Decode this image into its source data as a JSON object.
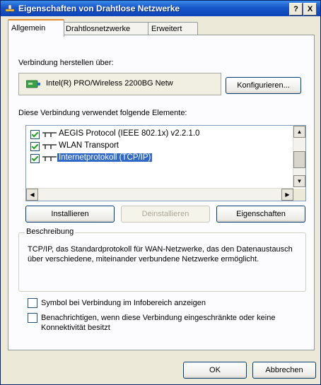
{
  "window": {
    "title": "Eigenschaften von Drahtlose Netzwerke",
    "help_label": "?",
    "close_label": "X"
  },
  "tabs": [
    {
      "label": "Allgemein",
      "active": true
    },
    {
      "label": "Drahtlosnetzwerke",
      "active": false
    },
    {
      "label": "Erweitert",
      "active": false
    }
  ],
  "connection": {
    "label": "Verbindung herstellen über:",
    "adapter": "Intel(R) PRO/Wireless 2200BG Netw",
    "configure_button": "Konfigurieren..."
  },
  "components": {
    "label": "Diese Verbindung verwendet folgende Elemente:",
    "items": [
      {
        "label": "AEGIS Protocol (IEEE 802.1x) v2.2.1.0",
        "checked": true,
        "selected": false
      },
      {
        "label": "WLAN Transport",
        "checked": true,
        "selected": false
      },
      {
        "label": "Internetprotokoll (TCP/IP)",
        "checked": true,
        "selected": true
      }
    ]
  },
  "actions": {
    "install": "Installieren",
    "uninstall": "Deinstallieren",
    "properties": "Eigenschaften"
  },
  "description": {
    "title": "Beschreibung",
    "text": "TCP/IP, das Standardprotokoll für WAN-Netzwerke, das den Datenaustausch über verschiedene, miteinander verbundene Netzwerke ermöglicht."
  },
  "options": {
    "show_icon": {
      "label": "Symbol bei Verbindung im Infobereich anzeigen",
      "checked": false
    },
    "notify": {
      "label": "Benachrichtigen, wenn diese Verbindung eingeschränkte oder keine Konnektivität besitzt",
      "checked": false
    }
  },
  "dialog_buttons": {
    "ok": "OK",
    "cancel": "Abbrechen"
  },
  "colors": {
    "titlebar": "#1756c9",
    "selection": "#316ac5",
    "tab_highlight": "#e68b2c"
  }
}
